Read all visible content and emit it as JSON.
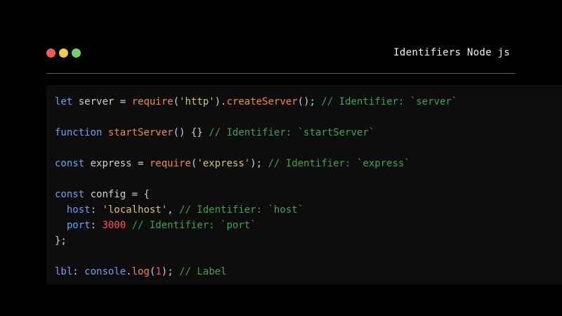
{
  "window": {
    "title": "Identifiers Node js",
    "dots": [
      {
        "name": "close",
        "color": "#ed5a5a"
      },
      {
        "name": "minimize",
        "color": "#f2c94c"
      },
      {
        "name": "maximize",
        "color": "#6fd36a"
      }
    ]
  },
  "colors": {
    "background": "#000000",
    "panel": "#0d0d0d",
    "keyword": "#6aa0f5",
    "identifier": "#c9d1d9",
    "call": "#f08a3c",
    "string": "#d4c07a",
    "comment": "#3fa34d",
    "number": "#ff5555",
    "punctuation": "#c9d1d9"
  },
  "code_lines": [
    [
      {
        "t": "let",
        "k": "keyword"
      },
      {
        "t": " server = ",
        "k": "identifier"
      },
      {
        "t": "require",
        "k": "call"
      },
      {
        "t": "(",
        "k": "punctuation"
      },
      {
        "t": "'http'",
        "k": "string"
      },
      {
        "t": ").",
        "k": "punctuation"
      },
      {
        "t": "createServer",
        "k": "call"
      },
      {
        "t": "(); ",
        "k": "punctuation"
      },
      {
        "t": "// Identifier: `server`",
        "k": "comment"
      }
    ],
    [],
    [
      {
        "t": "function",
        "k": "keyword"
      },
      {
        "t": " ",
        "k": "identifier"
      },
      {
        "t": "startServer",
        "k": "call"
      },
      {
        "t": "() {} ",
        "k": "punctuation"
      },
      {
        "t": "// Identifier: `startServer`",
        "k": "comment"
      }
    ],
    [],
    [
      {
        "t": "const",
        "k": "keyword"
      },
      {
        "t": " express = ",
        "k": "identifier"
      },
      {
        "t": "require",
        "k": "call"
      },
      {
        "t": "(",
        "k": "punctuation"
      },
      {
        "t": "'express'",
        "k": "string"
      },
      {
        "t": "); ",
        "k": "punctuation"
      },
      {
        "t": "// Identifier: `express`",
        "k": "comment"
      }
    ],
    [],
    [
      {
        "t": "const",
        "k": "keyword"
      },
      {
        "t": " config = {",
        "k": "identifier"
      }
    ],
    [
      {
        "t": "  host",
        "k": "keyword"
      },
      {
        "t": ": ",
        "k": "punctuation"
      },
      {
        "t": "'localhost'",
        "k": "string"
      },
      {
        "t": ", ",
        "k": "punctuation"
      },
      {
        "t": "// Identifier: `host`",
        "k": "comment"
      }
    ],
    [
      {
        "t": "  port",
        "k": "keyword"
      },
      {
        "t": ": ",
        "k": "punctuation"
      },
      {
        "t": "3000",
        "k": "number"
      },
      {
        "t": " ",
        "k": "punctuation"
      },
      {
        "t": "// Identifier: `port`",
        "k": "comment"
      }
    ],
    [
      {
        "t": "};",
        "k": "punctuation"
      }
    ],
    [],
    [
      {
        "t": "lbl",
        "k": "keyword"
      },
      {
        "t": ": ",
        "k": "punctuation"
      },
      {
        "t": "console",
        "k": "keyword"
      },
      {
        "t": ".",
        "k": "punctuation"
      },
      {
        "t": "log",
        "k": "call"
      },
      {
        "t": "(",
        "k": "punctuation"
      },
      {
        "t": "1",
        "k": "number"
      },
      {
        "t": "); ",
        "k": "punctuation"
      },
      {
        "t": "// Label",
        "k": "comment"
      }
    ]
  ]
}
